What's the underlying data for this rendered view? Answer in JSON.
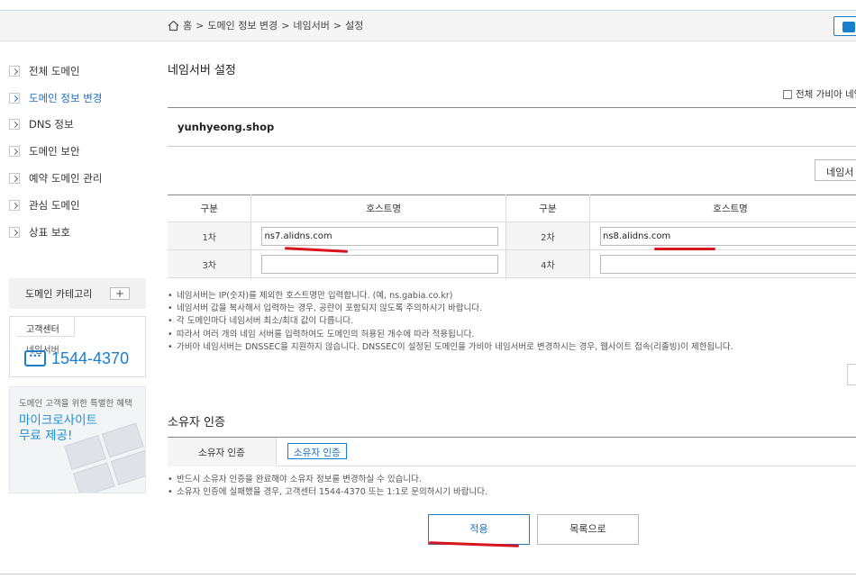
{
  "breadcrumb": {
    "home": "홈",
    "sep": ">",
    "item1": "도메인 정보 변경",
    "item2": "네임서버",
    "item3": "설정"
  },
  "sidebar": {
    "items": [
      {
        "label": "전체 도메인",
        "active": false
      },
      {
        "label": "도메인 정보 변경",
        "active": true
      },
      {
        "label": "DNS 정보",
        "active": false
      },
      {
        "label": "도메인 보안",
        "active": false
      },
      {
        "label": "예약 도메인 관리",
        "active": false
      },
      {
        "label": "관심 도메인",
        "active": false
      },
      {
        "label": "상표 보호",
        "active": false
      }
    ],
    "category_label": "도메인 카테고리",
    "category_plus": "+",
    "cs_tab": "고객센터",
    "cs_sub": "네임서버",
    "cs_phone": "1544-4370",
    "banner_sub": "도메인 고객을 위한 특별한 혜택",
    "banner_title_1": "마이크로사이트",
    "banner_title_2": "무료 제공!"
  },
  "main": {
    "title": "네임서버 설정",
    "select_all": "전체 가비아 네임",
    "domain": "yunhyeong.shop",
    "ns_button": "네임서",
    "table": {
      "col_label": "구분",
      "col_host": "호스트명",
      "rows": [
        {
          "l1": "1차",
          "v1": "ns7.alidns.com",
          "l2": "2차",
          "v2": "ns8.alidns.com"
        },
        {
          "l1": "3차",
          "v1": "",
          "l2": "4차",
          "v2": ""
        }
      ]
    },
    "notes": [
      "네임서버는 IP(숫자)를 제외한 호스트명만 입력합니다. (예, ns.gabia.co.kr)",
      "네임서버 값을 복사해서 입력하는 경우, 공란이 포함되지 않도록 주의하시기 바랍니다.",
      "각 도메인마다 네임서버 최소/최대 값이 다릅니다.",
      "따라서 여러 개의 네임 서버를 입력하여도 도메인의 허용된 개수에 따라 적용됩니다.",
      "가비아 네임서버는 DNSSEC을 지원하지 않습니다. DNSSEC이 설정된 도메인을 가비아 네임서버로 변경하시는 경우, 웹사이트 접속(리졸빙)이 제한됩니다."
    ],
    "owner_title": "소유자 인증",
    "owner_label": "소유자 인증",
    "owner_button": "소유자 인증",
    "owner_notes": [
      "반드시 소유자 인증을 완료해야 소유자 정보를 변경하실 수 있습니다.",
      "소유자 인증에 실패했을 경우, 고객센터 1544-4370 또는 1:1로 문의하시기 바랍니다."
    ],
    "apply_button": "적용",
    "list_button": "목록으로"
  },
  "colors": {
    "accent": "#1a7ecf",
    "annotation": "#d8141c"
  }
}
